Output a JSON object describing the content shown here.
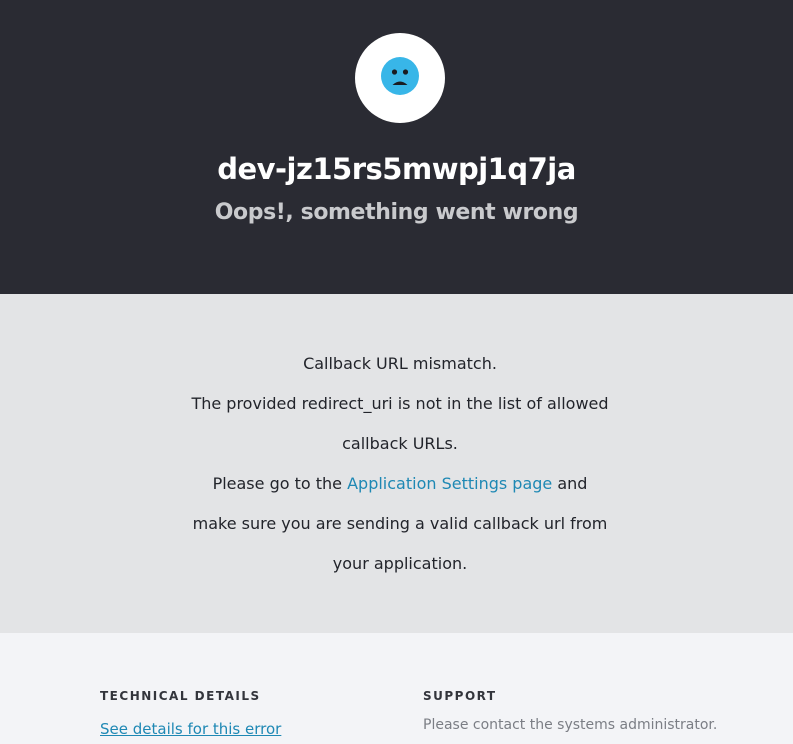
{
  "header": {
    "tenant": "dev-jz15rs5mwpj1q7ja",
    "subtitle": "Oops!, something went wrong",
    "icon": "sad-face-icon",
    "icon_color": "#38b6e8"
  },
  "message": {
    "line1": "Callback URL mismatch.",
    "line2": "The provided redirect_uri is not in the list of allowed callback URLs.",
    "line3_prefix": "Please go to the ",
    "line3_link": "Application Settings page",
    "line3_suffix": " and make sure you are sending a valid callback url from your application."
  },
  "footer": {
    "technical_title": "TECHNICAL DETAILS",
    "details_link": "See details for this error",
    "support_title": "SUPPORT",
    "support_text": "Please contact the systems administrator."
  },
  "colors": {
    "header_bg": "#2a2b33",
    "message_bg": "#e3e4e6",
    "footer_bg": "#f3f4f7",
    "link": "#1e88b4"
  }
}
